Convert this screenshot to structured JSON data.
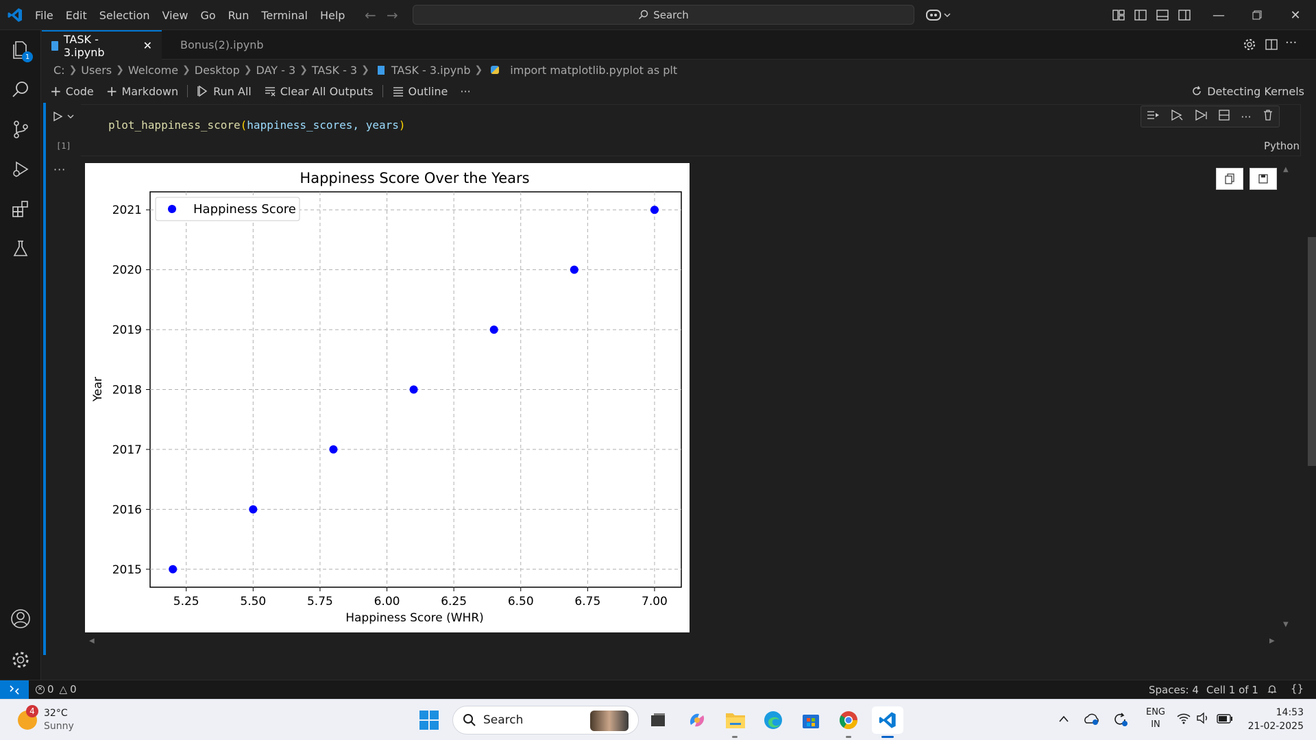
{
  "titlebar": {
    "menu": [
      "File",
      "Edit",
      "Selection",
      "View",
      "Go",
      "Run",
      "Terminal",
      "Help"
    ],
    "search_label": "Search"
  },
  "activity": {
    "explorer_badge": "1"
  },
  "tabs": [
    {
      "label": "TASK - 3.ipynb",
      "active": true
    },
    {
      "label": "Bonus(2).ipynb",
      "active": false
    }
  ],
  "breadcrumb": [
    "C:",
    "Users",
    "Welcome",
    "Desktop",
    "DAY - 3",
    "TASK - 3",
    "TASK - 3.ipynb",
    "import matplotlib.pyplot as plt"
  ],
  "nbtoolbar": {
    "code": "Code",
    "markdown": "Markdown",
    "run_all": "Run All",
    "clear_outputs": "Clear All Outputs",
    "outline": "Outline",
    "more": "···",
    "kernel": "Detecting Kernels"
  },
  "cell": {
    "code_fn": "plot_happiness_score",
    "code_args": "happiness_scores, years",
    "exec_count": "[1]",
    "language": "Python",
    "output_dots": "···"
  },
  "chart_data": {
    "type": "scatter",
    "title": "Happiness Score Over the Years",
    "xlabel": "Happiness Score (WHR)",
    "ylabel": "Year",
    "xlim": [
      5.115,
      7.1
    ],
    "ylim": [
      2014.7,
      2021.3
    ],
    "xticks": [
      "5.25",
      "5.50",
      "5.75",
      "6.00",
      "6.25",
      "6.50",
      "6.75",
      "7.00"
    ],
    "yticks": [
      "2015",
      "2016",
      "2017",
      "2018",
      "2019",
      "2020",
      "2021"
    ],
    "grid": true,
    "legend": "upper-left",
    "series": [
      {
        "name": "Happiness Score",
        "color": "#0000ff",
        "x": [
          5.2,
          5.5,
          5.8,
          6.1,
          6.4,
          6.7,
          7.0
        ],
        "y": [
          2015,
          2016,
          2017,
          2018,
          2019,
          2020,
          2021
        ]
      }
    ]
  },
  "statusbar": {
    "errors": "0",
    "warnings": "0",
    "spaces": "Spaces: 4",
    "cell": "Cell 1 of 1"
  },
  "taskbar": {
    "weather_temp": "32°C",
    "weather_desc": "Sunny",
    "weather_badge": "4",
    "search_label": "Search",
    "lang_top": "ENG",
    "lang_bottom": "IN",
    "time": "14:53",
    "date": "21-02-2025"
  },
  "colors": {
    "accent": "#0078d4",
    "editor_bg": "#1f1f1f",
    "sidebar_bg": "#181818",
    "marker": "#0000ff"
  }
}
